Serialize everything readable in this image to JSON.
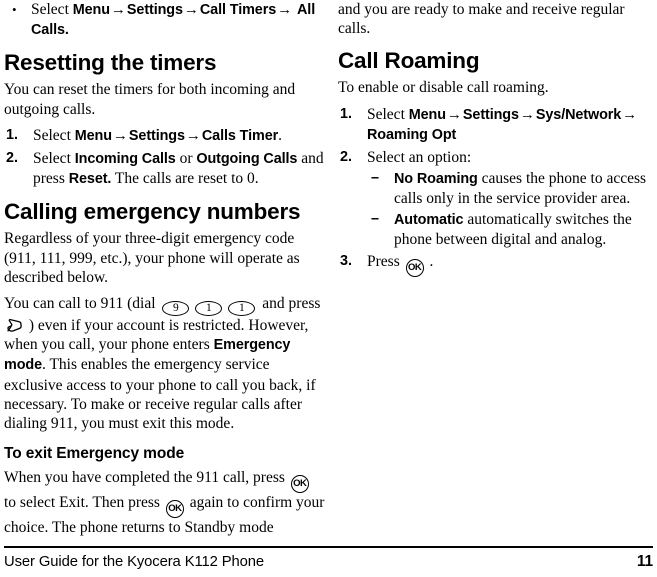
{
  "document": {
    "title": "User Guide for the Kyocera K112 Phone",
    "page_number": "11"
  },
  "icons": {
    "key_9": "9",
    "key_1": "1",
    "key_ok": "OK",
    "send_key": "send-key-icon"
  },
  "arrow": "→",
  "bullet_glyph": "•",
  "dash_glyph": "–",
  "left_column": {
    "top_bullet": {
      "marker": "•",
      "select_label": "Select ",
      "menu": "Menu",
      "settings": "Settings",
      "call_timers": "Call Timers",
      "all_calls": "All Calls."
    },
    "resetting": {
      "heading": "Resetting the timers",
      "intro": "You can reset the timers for both incoming and outgoing calls.",
      "steps": [
        {
          "marker": "1.",
          "select_label": "Select ",
          "menu": "Menu",
          "settings": "Settings",
          "calls_timer": "Calls Timer",
          "period": "."
        },
        {
          "marker": "2.",
          "select_label": "Select ",
          "incoming": "Incoming Calls",
          "or_label": " or ",
          "outgoing": "Outgoing Calls",
          "and_press": " and press ",
          "reset": "Reset.",
          "tail": " The calls are reset to 0."
        }
      ]
    },
    "emergency": {
      "heading": "Calling emergency numbers",
      "para1": "Regardless of your three-digit emergency code (911, 111, 999, etc.), your phone will operate as described below.",
      "para2_part1": "You can call to 911 (dial ",
      "para2_part2": " and press ",
      "para2_part3": " ) even if your account is restricted. However, when you call, your phone enters ",
      "emergency_mode_bold": "Emergency mode",
      "para2_part4": ". This enables the emergency service exclusive access to your phone to call you back, if necessary. To make or receive regular calls after dialing 911, you must exit this mode."
    },
    "exit_mode": {
      "heading": "To exit Emergency mode",
      "para_part1": "When you have completed the 911 call, press ",
      "para_part2": " to select Exit. Then press ",
      "para_part3": " again to confirm your choice. The phone returns to Standby mode"
    }
  },
  "right_column": {
    "continuation": "and you are ready to make and receive regular calls.",
    "call_roaming": {
      "heading": "Call Roaming",
      "intro": "To enable or disable call roaming.",
      "step1": {
        "marker": "1.",
        "select_label": "Select ",
        "menu": "Menu",
        "settings": "Settings",
        "sys_network": "Sys/Network",
        "roaming_opt": "Roaming Opt"
      },
      "step2": {
        "marker": "2.",
        "text": "Select an option:",
        "options": [
          {
            "marker": "–",
            "name": "No Roaming",
            "desc": " causes the phone to access calls only in the service provider area."
          },
          {
            "marker": "–",
            "name": "Automatic",
            "desc": " automatically switches the phone between digital and analog."
          }
        ]
      },
      "step3": {
        "marker": "3.",
        "press_label": "Press ",
        "period": "."
      }
    }
  }
}
